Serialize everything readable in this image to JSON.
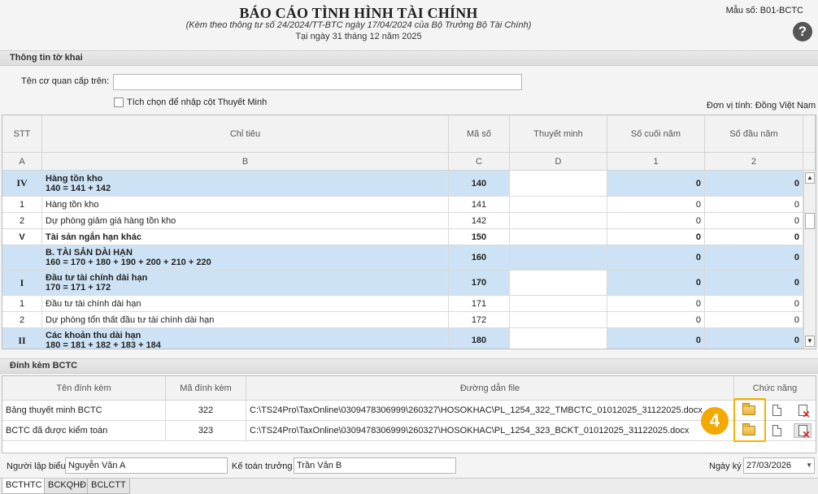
{
  "header": {
    "title": "BÁO CÁO TÌNH HÌNH TÀI CHÍNH",
    "subtitle": "(Kèm theo thông tư số 24/2024/TT-BTC ngày 17/04/2024 của Bộ Trưởng Bộ Tài Chính)",
    "date": "Tại ngày 31 tháng 12 năm 2025",
    "form_code": "Mẫu số: B01-BCTC",
    "help": "?"
  },
  "info": {
    "section": "Thông tin tờ khai",
    "agency_label": "Tên cơ quan cấp trên:",
    "agency_value": "",
    "checkbox_label": "Tích chọn để nhập cột Thuyết Minh",
    "unit": "Đơn vị tính: Đồng Việt Nam"
  },
  "grid": {
    "headers": [
      "STT",
      "Chỉ tiêu",
      "Mã số",
      "Thuyết minh",
      "Số cuối năm",
      "Số đầu năm"
    ],
    "subheaders": [
      "A",
      "B",
      "C",
      "D",
      "1",
      "2"
    ],
    "rows": [
      {
        "stt": "IV",
        "name": "Hàng tồn kho",
        "formula": "140 = 141 + 142",
        "code": "140",
        "end": "0",
        "start": "0"
      },
      {
        "stt": "1",
        "name": "Hàng tồn kho",
        "formula": "",
        "code": "141",
        "end": "0",
        "start": "0"
      },
      {
        "stt": "2",
        "name": "Dự phòng giảm giá hàng tồn kho",
        "formula": "",
        "code": "142",
        "end": "0",
        "start": "0"
      },
      {
        "stt": "V",
        "name": "Tài sản ngắn hạn khác",
        "formula": "",
        "code": "150",
        "end": "0",
        "start": "0"
      },
      {
        "stt": "",
        "name": "B. TÀI SẢN DÀI HẠN",
        "formula": "160 = 170 + 180 + 190 + 200 + 210 + 220",
        "code": "160",
        "end": "0",
        "start": "0"
      },
      {
        "stt": "I",
        "name": "Đầu tư tài chính dài hạn",
        "formula": "170 = 171 + 172",
        "code": "170",
        "end": "0",
        "start": "0"
      },
      {
        "stt": "1",
        "name": "Đầu tư tài chính dài hạn",
        "formula": "",
        "code": "171",
        "end": "0",
        "start": "0"
      },
      {
        "stt": "2",
        "name": "Dự phòng tổn thất đầu tư tài chính dài hạn",
        "formula": "",
        "code": "172",
        "end": "0",
        "start": "0"
      },
      {
        "stt": "II",
        "name": "Các khoản thu dài hạn",
        "formula": "180 = 181 + 182 + 183 + 184",
        "code": "180",
        "end": "0",
        "start": "0"
      }
    ]
  },
  "attachments": {
    "section": "Đính kèm BCTC",
    "headers": [
      "Tên đính kèm",
      "Mã đính kèm",
      "Đường dẫn file",
      "Chức năng"
    ],
    "rows": [
      {
        "name": "Bảng thuyết minh BCTC",
        "code": "322",
        "path": "C:\\TS24Pro\\TaxOnline\\0309478306999\\260327\\HOSOKHAC\\PL_1254_322_TMBCTC_01012025_31122025.docx"
      },
      {
        "name": "BCTC đã được kiểm toán",
        "code": "323",
        "path": "C:\\TS24Pro\\TaxOnline\\0309478306999\\260327\\HOSOKHAC\\PL_1254_323_BCKT_01012025_31122025.docx"
      }
    ],
    "badge": "4"
  },
  "footer": {
    "preparer_label": "Người lập biểu",
    "preparer": "Nguyễn Văn A",
    "accountant_label": "Kế toán trưởng",
    "accountant": "Trần Văn B",
    "date_label": "Ngày ký",
    "date": "27/03/2026"
  },
  "tabs": [
    "BCTHTC",
    "BCKQHĐ",
    "BCLCTT"
  ],
  "colors": {
    "highlight_row": "#cde3f5",
    "badge": "#f2a900"
  }
}
